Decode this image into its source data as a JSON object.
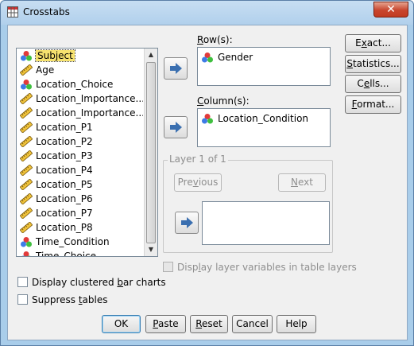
{
  "window": {
    "title": "Crosstabs",
    "close_label": "✕"
  },
  "variables": [
    {
      "label": "Subject",
      "icon": "nominal-icon",
      "selected": true
    },
    {
      "label": "Age",
      "icon": "scale-icon"
    },
    {
      "label": "Location_Choice",
      "icon": "nominal-icon"
    },
    {
      "label": "Location_Importance...",
      "icon": "scale-icon"
    },
    {
      "label": "Location_Importance...",
      "icon": "scale-icon"
    },
    {
      "label": "Location_P1",
      "icon": "scale-icon"
    },
    {
      "label": "Location_P2",
      "icon": "scale-icon"
    },
    {
      "label": "Location_P3",
      "icon": "scale-icon"
    },
    {
      "label": "Location_P4",
      "icon": "scale-icon"
    },
    {
      "label": "Location_P5",
      "icon": "scale-icon"
    },
    {
      "label": "Location_P6",
      "icon": "scale-icon"
    },
    {
      "label": "Location_P7",
      "icon": "scale-icon"
    },
    {
      "label": "Location_P8",
      "icon": "scale-icon"
    },
    {
      "label": "Time_Condition",
      "icon": "nominal-icon"
    },
    {
      "label": "Time_Choice",
      "icon": "nominal-icon"
    }
  ],
  "rows": {
    "label_pre": "",
    "label_u": "R",
    "label_post": "ow(s):",
    "items": [
      {
        "label": "Gender",
        "icon": "nominal-icon"
      }
    ]
  },
  "columns": {
    "label_pre": "",
    "label_u": "C",
    "label_post": "olumn(s):",
    "items": [
      {
        "label": "Location_Condition",
        "icon": "nominal-icon"
      }
    ]
  },
  "layer": {
    "title": "Layer 1 of 1",
    "previous_pre": "Pre",
    "previous_u": "v",
    "previous_post": "ious",
    "next_pre": "",
    "next_u": "N",
    "next_post": "ext"
  },
  "side_buttons": [
    {
      "pre": "E",
      "u": "x",
      "post": "act..."
    },
    {
      "pre": "",
      "u": "S",
      "post": "tatistics..."
    },
    {
      "pre": "C",
      "u": "e",
      "post": "lls..."
    },
    {
      "pre": "",
      "u": "F",
      "post": "ormat..."
    }
  ],
  "options": {
    "display_layer": {
      "pre": "Disp",
      "u": "l",
      "post": "ay layer variables in table layers"
    },
    "clustered": {
      "pre": "Display clustered ",
      "u": "b",
      "post": "ar charts"
    },
    "suppress": {
      "pre": "Suppress ",
      "u": "t",
      "post": "ables"
    }
  },
  "bottom_buttons": [
    {
      "pre": "",
      "u": "",
      "post": "OK"
    },
    {
      "pre": "",
      "u": "P",
      "post": "aste"
    },
    {
      "pre": "",
      "u": "R",
      "post": "eset"
    },
    {
      "pre": "",
      "u": "",
      "post": "Cancel"
    },
    {
      "pre": "",
      "u": "",
      "post": "Help"
    }
  ]
}
